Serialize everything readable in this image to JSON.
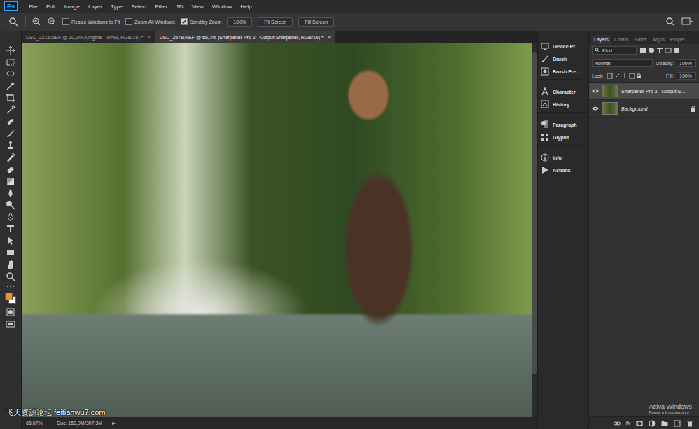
{
  "app": {
    "logo": "Ps"
  },
  "menu": [
    "File",
    "Edit",
    "Image",
    "Layer",
    "Type",
    "Select",
    "Filter",
    "3D",
    "View",
    "Window",
    "Help"
  ],
  "options_bar": {
    "checkboxes": [
      {
        "label": "Resize Windows to Fit",
        "checked": false
      },
      {
        "label": "Zoom All Windows",
        "checked": false
      },
      {
        "label": "Scrubby Zoom",
        "checked": true
      }
    ],
    "buttons": [
      "100%",
      "Fit Screen",
      "Fill Screen"
    ]
  },
  "doc_tabs": [
    {
      "label": "DSC_2215.NEF @ 30,2% (Original - RAW, RGB/16) *",
      "close": "×",
      "selected": false
    },
    {
      "label": "DSC_2578.NEF @ 66,7% (Sharpener Pro 3 - Output Sharpener, RGB/16) *",
      "close": "×",
      "selected": true
    }
  ],
  "tool_colors": {
    "foreground": "#e8912f",
    "background": "#ffffff"
  },
  "status_bar": {
    "zoom": "66,67%",
    "doc": "Doc: 153,9M/307,3M"
  },
  "side_panels": [
    [
      "Device Pr...",
      "Brush",
      "Brush Pre..."
    ],
    [
      "Character",
      "History"
    ],
    [
      "Paragraph",
      "Glyphs"
    ],
    [
      "Info",
      "Actions"
    ]
  ],
  "layers_panel": {
    "tabs": [
      {
        "label": "Layers",
        "selected": true
      },
      {
        "label": "Chann",
        "selected": false
      },
      {
        "label": "Paths",
        "selected": false
      },
      {
        "label": "Adjus",
        "selected": false
      },
      {
        "label": "Proper",
        "selected": false
      }
    ],
    "filter": "Kind",
    "blend_mode": "Normal",
    "opacity_label": "Opacity:",
    "opacity": "100%",
    "lock_label": "Lock:",
    "fill_label": "Fill:",
    "fill": "100%",
    "layers": [
      {
        "name": "Sharpener Pro 3 - Output S...",
        "selected": true,
        "visible": true,
        "locked": false,
        "italic": false
      },
      {
        "name": "Background",
        "selected": false,
        "visible": true,
        "locked": true,
        "italic": true
      }
    ],
    "footer_fx": "fx"
  },
  "overlays": {
    "watermark": "飞天资源论坛 feitianwu7.com",
    "activation_title": "Attiva Windows",
    "activation_subtitle": "Passa a Impostazioni"
  }
}
